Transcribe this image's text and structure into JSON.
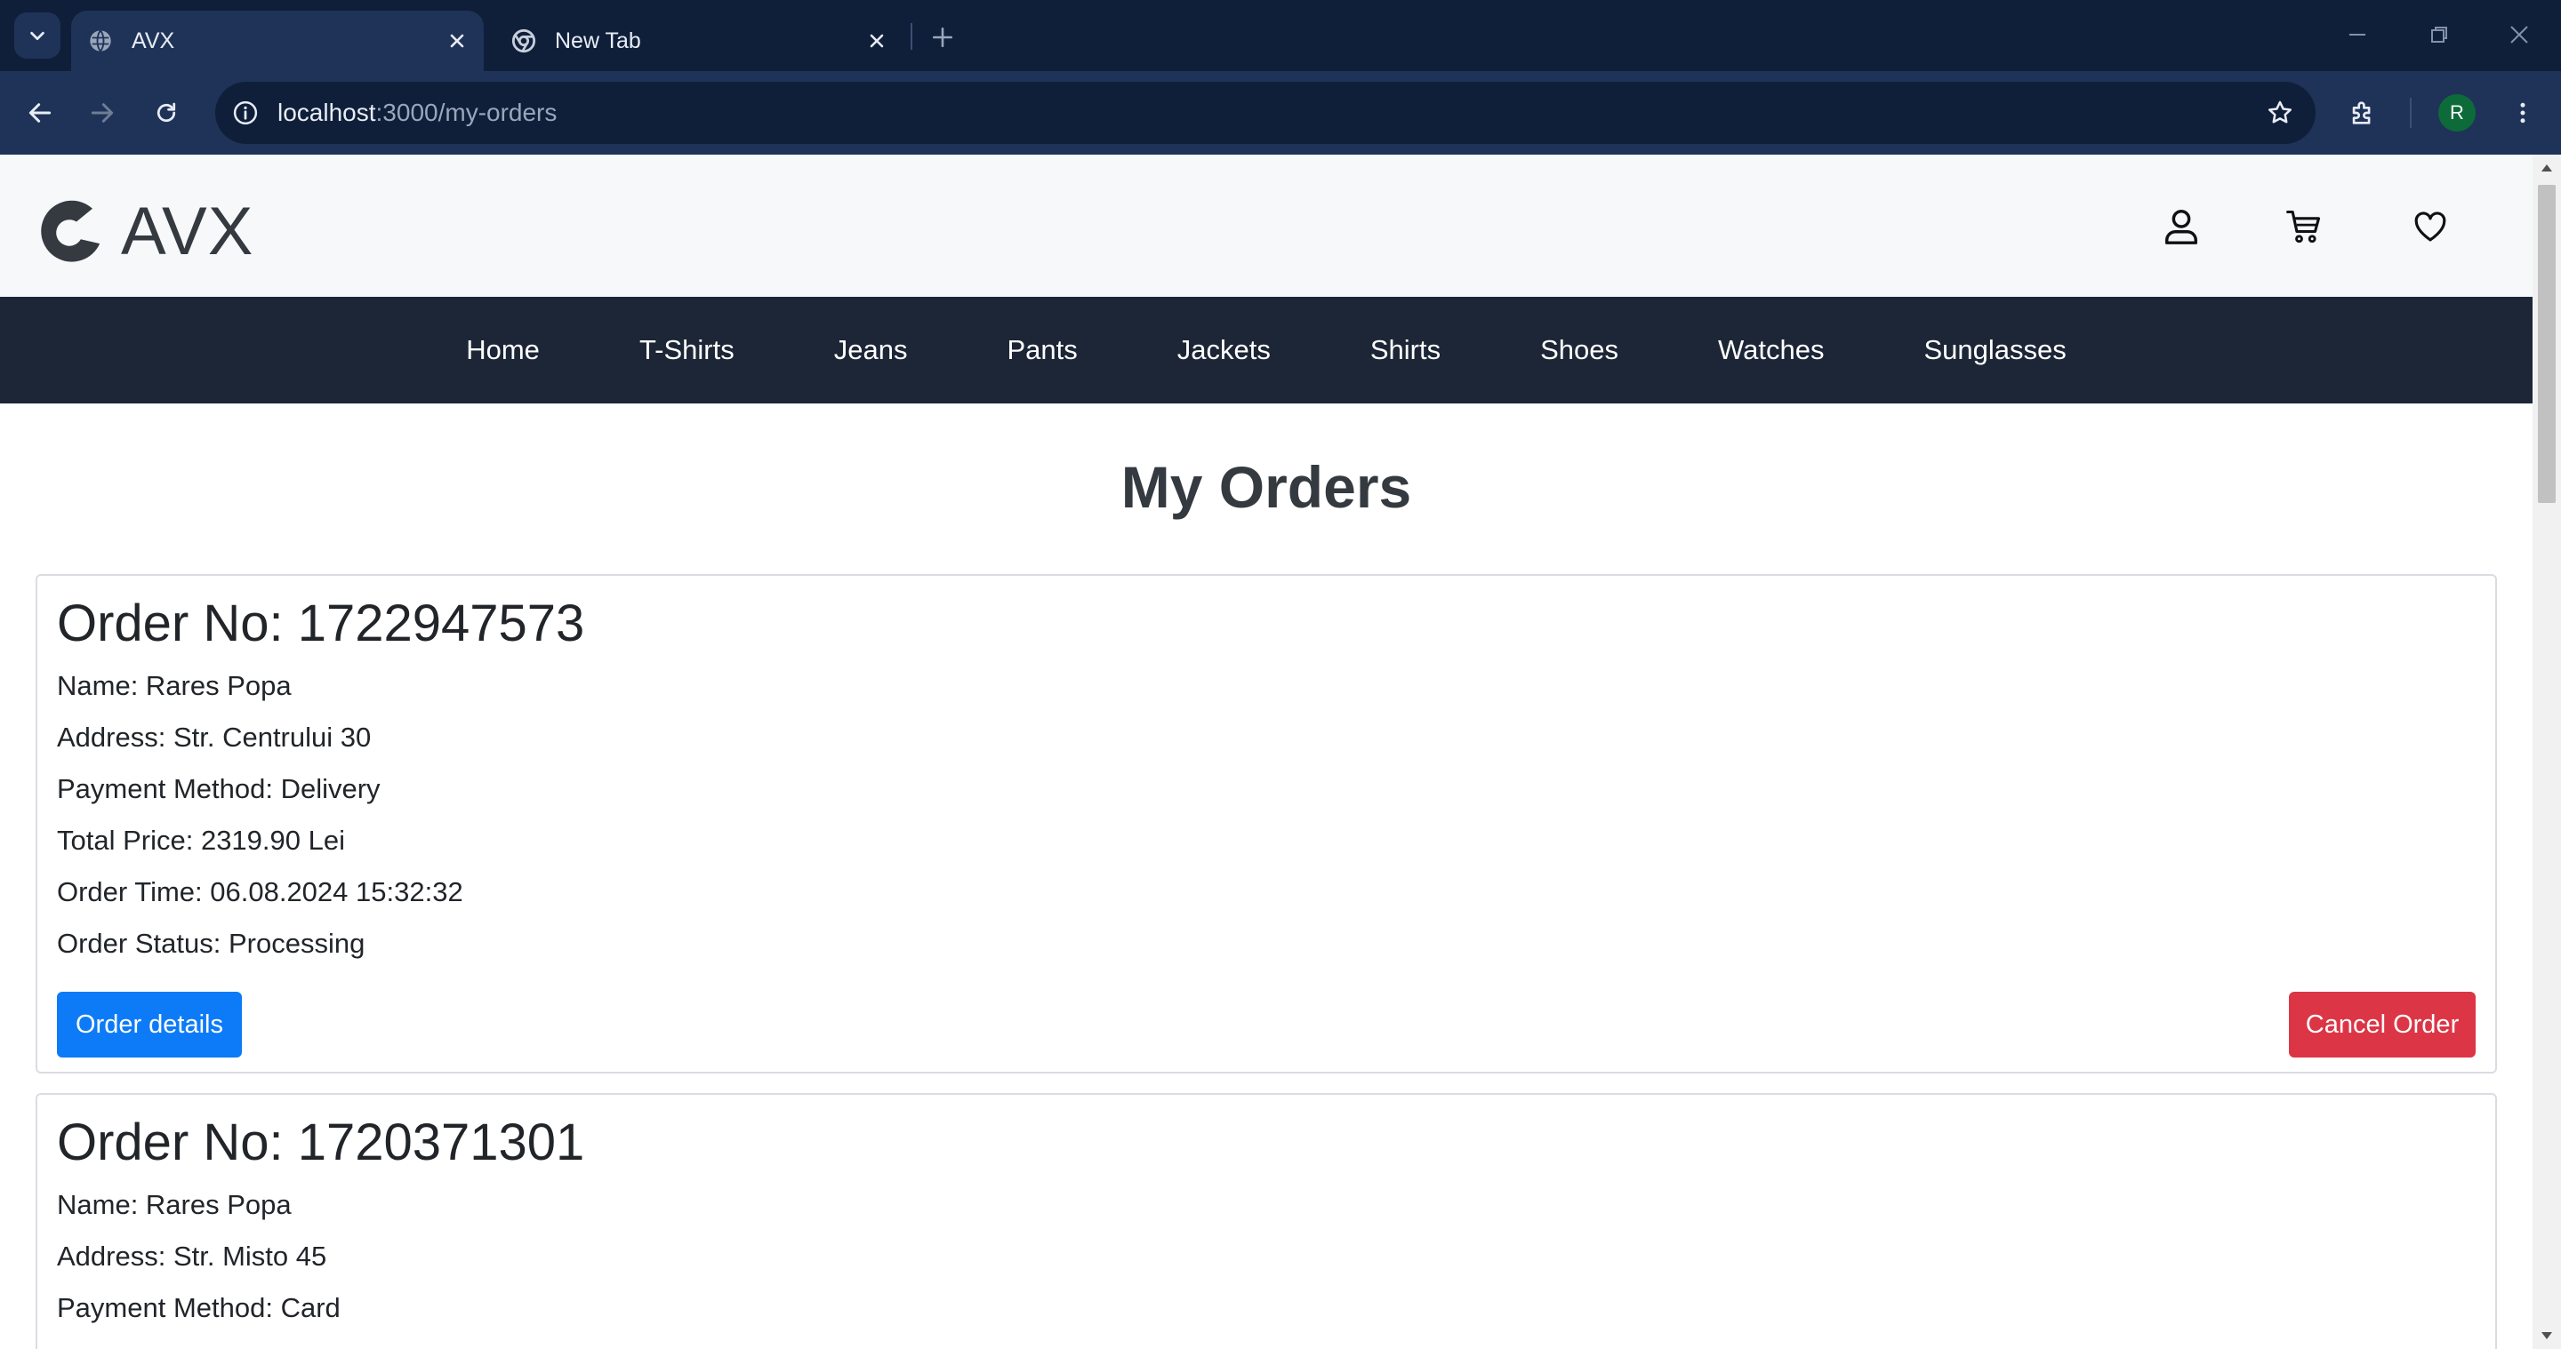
{
  "browser": {
    "tabs": [
      {
        "title": "AVX",
        "active": true
      },
      {
        "title": "New Tab",
        "active": false
      }
    ],
    "url": {
      "host": "localhost",
      "path": ":3000/my-orders"
    },
    "profile_initial": "R"
  },
  "site": {
    "logo_text": "AVX",
    "nav": [
      "Home",
      "T-Shirts",
      "Jeans",
      "Pants",
      "Jackets",
      "Shirts",
      "Shoes",
      "Watches",
      "Sunglasses"
    ],
    "page_title": "My Orders",
    "accent_colors": {
      "primary": "#0d7bf7",
      "danger": "#dc3545",
      "nav_bg": "#1d2636"
    }
  },
  "orders": [
    {
      "order_no": "Order No: 1722947573",
      "name": "Name: Rares Popa",
      "address": "Address: Str. Centrului 30",
      "payment": "Payment Method: Delivery",
      "total": "Total Price: 2319.90 Lei",
      "time": "Order Time: 06.08.2024 15:32:32",
      "status": "Order Status: Processing",
      "details_label": "Order details",
      "cancel_label": "Cancel Order"
    },
    {
      "order_no": "Order No: 1720371301",
      "name": "Name: Rares Popa",
      "address": "Address: Str. Misto 45",
      "payment": "Payment Method: Card"
    }
  ]
}
